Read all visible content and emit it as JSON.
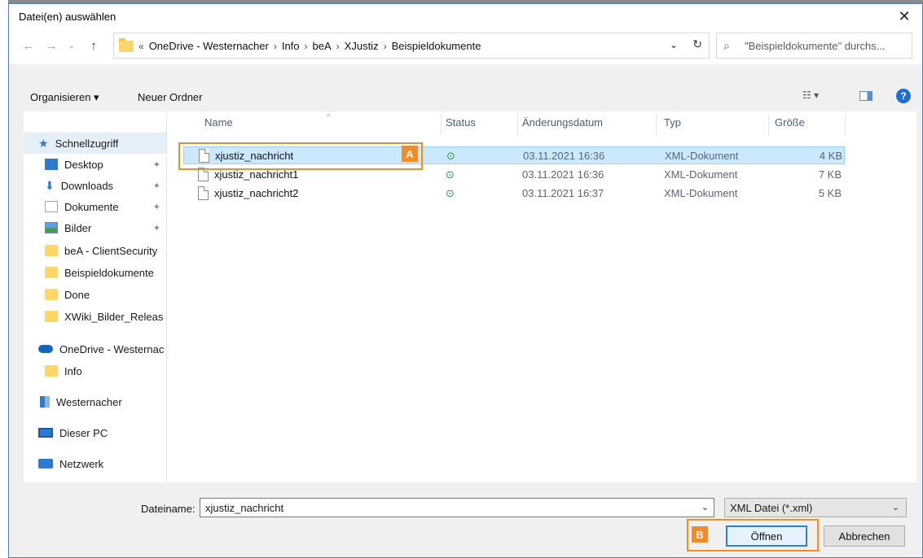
{
  "dialog": {
    "title": "Datei(en) auswählen"
  },
  "nav": {
    "crumbs_prefix": "«",
    "breadcrumbs": [
      "OneDrive - Westernacher",
      "Info",
      "beA",
      "XJustiz",
      "Beispieldokumente"
    ],
    "search_placeholder": "\"Beispieldokumente\" durchs..."
  },
  "toolbar": {
    "organize": "Organisieren ▾",
    "new_folder": "Neuer Ordner"
  },
  "sidebar": {
    "items": [
      {
        "label": "Schnellzugriff",
        "icon": "star-icon"
      },
      {
        "label": "Desktop",
        "icon": "desktop-icon"
      },
      {
        "label": "Downloads",
        "icon": "download-icon"
      },
      {
        "label": "Dokumente",
        "icon": "documents-icon"
      },
      {
        "label": "Bilder",
        "icon": "pictures-icon"
      },
      {
        "label": "beA - ClientSecurity",
        "icon": "folder-icon"
      },
      {
        "label": "Beispieldokumente",
        "icon": "folder-icon"
      },
      {
        "label": "Done",
        "icon": "folder-icon"
      },
      {
        "label": "XWiki_Bilder_Releas",
        "icon": "folder-icon"
      },
      {
        "label": "OneDrive - Westernac",
        "icon": "cloud-icon"
      },
      {
        "label": "Info",
        "icon": "folder-icon"
      },
      {
        "label": "Westernacher",
        "icon": "building-icon"
      },
      {
        "label": "Dieser PC",
        "icon": "pc-icon"
      },
      {
        "label": "Netzwerk",
        "icon": "network-icon"
      }
    ]
  },
  "columns": {
    "name": "Name",
    "status": "Status",
    "date": "Änderungsdatum",
    "type": "Typ",
    "size": "Größe"
  },
  "files": [
    {
      "name": "xjustiz_nachricht",
      "status": "⊙",
      "date": "03.11.2021 16:36",
      "type": "XML-Dokument",
      "size": "4 KB"
    },
    {
      "name": "xjustiz_nachricht1",
      "status": "⊙",
      "date": "03.11.2021 16:36",
      "type": "XML-Dokument",
      "size": "7 KB"
    },
    {
      "name": "xjustiz_nachricht2",
      "status": "⊙",
      "date": "03.11.2021 16:37",
      "type": "XML-Dokument",
      "size": "5 KB"
    }
  ],
  "footer": {
    "filename_label": "Dateiname:",
    "filename_value": "xjustiz_nachricht",
    "filetype_value": "XML Datei (*.xml)",
    "open_button": "Öffnen",
    "cancel_button": "Abbrechen"
  },
  "markers": {
    "a": "A",
    "b": "B"
  },
  "colors": {
    "accent": "#f28c28",
    "selection": "#cce8ff",
    "primary_button_border": "#2f7fd1"
  }
}
